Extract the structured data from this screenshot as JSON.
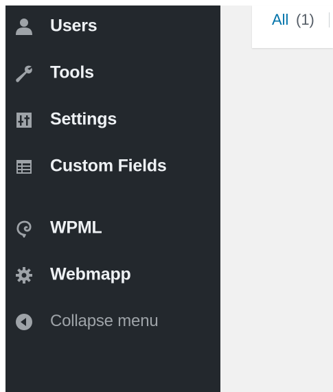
{
  "sidebar": {
    "items": [
      {
        "label": "Users",
        "icon": "user-icon"
      },
      {
        "label": "Tools",
        "icon": "wrench-icon"
      },
      {
        "label": "Settings",
        "icon": "settings-sliders-icon"
      },
      {
        "label": "Custom Fields",
        "icon": "custom-fields-table-icon"
      },
      {
        "label": "WPML",
        "icon": "wpml-icon"
      },
      {
        "label": "Webmapp",
        "icon": "gear-icon"
      }
    ],
    "collapse": {
      "label": "Collapse menu",
      "icon": "collapse-arrow-icon"
    }
  },
  "filters": {
    "all_label": "All",
    "all_count": "(1)"
  },
  "colors": {
    "sidebar_bg": "#23282d",
    "sidebar_text": "#eef1f4",
    "icon": "#9ea3a8",
    "link": "#0073aa",
    "content_bg": "#f1f1f1"
  }
}
